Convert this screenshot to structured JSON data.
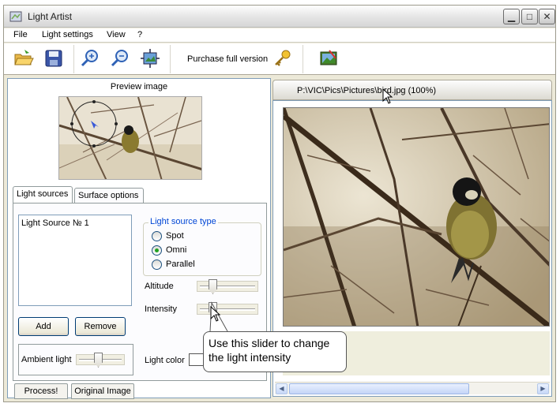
{
  "window": {
    "title": "Light Artist"
  },
  "window_controls": {
    "minimize": "▁",
    "maximize": "□",
    "close": "✕"
  },
  "menu": {
    "file": "File",
    "light_settings": "Light settings",
    "view": "View",
    "help": "?"
  },
  "toolbar": {
    "icons": [
      "open-folder-icon",
      "save-disk-icon",
      "zoom-in-icon",
      "zoom-out-icon",
      "fit-image-icon",
      "key-icon",
      "picture-icon"
    ],
    "purchase_label": "Purchase full version"
  },
  "preview": {
    "label": "Preview image"
  },
  "tabs": {
    "light_sources": "Light sources",
    "surface_options": "Surface options",
    "active": "Light sources"
  },
  "light_sources": {
    "items": [
      "Light Source № 1"
    ]
  },
  "buttons": {
    "add": "Add",
    "remove": "Remove",
    "process": "Process!",
    "original_image": "Original Image"
  },
  "ambient": {
    "label": "Ambient light",
    "value": 0.45
  },
  "light_type": {
    "legend": "Light source type",
    "options": [
      "Spot",
      "Omni",
      "Parallel"
    ],
    "selected": "Omni"
  },
  "sliders": {
    "altitude_label": "Altitude",
    "altitude_value": 0.22,
    "intensity_label": "Intensity",
    "intensity_value": 0.22
  },
  "light_color": {
    "label": "Light color",
    "value": "#ffffff"
  },
  "document": {
    "tab_title": "P:\\VIC\\Pics\\Pictures\\bird.jpg (100%)"
  },
  "tooltip": {
    "text_line1": "Use this slider to change",
    "text_line2": "the light intensity"
  },
  "colors": {
    "panel": "#ece9d8",
    "accent_blue": "#0046d5",
    "radio_dot": "#21a121"
  }
}
